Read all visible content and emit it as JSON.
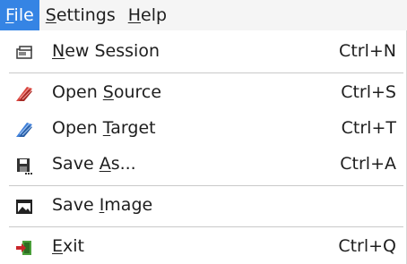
{
  "menubar": {
    "items": [
      {
        "pre": "",
        "mnemonic": "F",
        "post": "ile"
      },
      {
        "pre": "",
        "mnemonic": "S",
        "post": "ettings"
      },
      {
        "pre": "",
        "mnemonic": "H",
        "post": "elp"
      }
    ]
  },
  "menu": {
    "items": [
      {
        "icon": "session-icon",
        "pre": "",
        "mnemonic": "N",
        "post": "ew Session",
        "shortcut": "Ctrl+N"
      },
      {
        "icon": "open-source-icon",
        "pre": "Open ",
        "mnemonic": "S",
        "post": "ource",
        "shortcut": "Ctrl+S"
      },
      {
        "icon": "open-target-icon",
        "pre": "Open ",
        "mnemonic": "T",
        "post": "arget",
        "shortcut": "Ctrl+T"
      },
      {
        "icon": "save-as-icon",
        "pre": "Save ",
        "mnemonic": "A",
        "post": "s...",
        "shortcut": "Ctrl+A"
      },
      {
        "icon": "image-icon",
        "pre": "Save ",
        "mnemonic": "I",
        "post": "mage",
        "shortcut": ""
      },
      {
        "icon": "exit-icon",
        "pre": "",
        "mnemonic": "E",
        "post": "xit",
        "shortcut": "Ctrl+Q"
      }
    ]
  },
  "colors": {
    "highlight": "#3584e4",
    "source_icon": "#d9463f",
    "target_icon": "#3f7fd9",
    "exit_icon": "#c8262a"
  }
}
